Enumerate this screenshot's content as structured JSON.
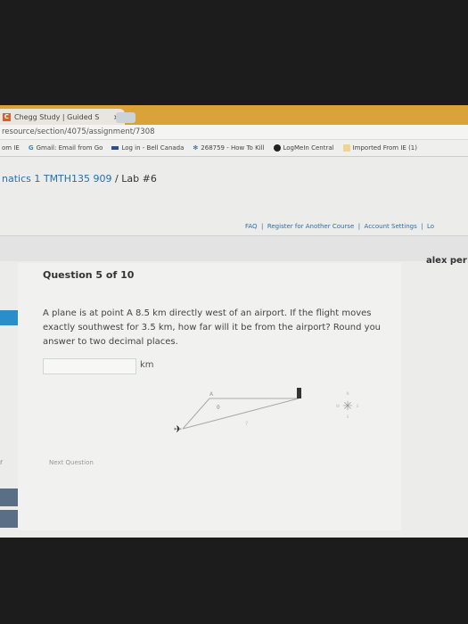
{
  "browser": {
    "tab_title": "Chegg Study | Guided S",
    "tab_close": "×",
    "favicon": "C",
    "address": "resource/section/4075/assignment/7308",
    "bookmarks": [
      {
        "label": "om IE",
        "icon": ""
      },
      {
        "label": "Gmail: Email from Go",
        "icon": "google-icon"
      },
      {
        "label": "Log in - Bell Canada",
        "icon": "bell-icon"
      },
      {
        "label": "268759 - How To Kill",
        "icon": "pinwheel-icon"
      },
      {
        "label": "LogMeIn Central",
        "icon": "logmein-icon"
      },
      {
        "label": "Imported From IE (1)",
        "icon": "folder-icon"
      }
    ]
  },
  "breadcrumb": {
    "course": "natics 1 TMTH135 909",
    "separator": " / ",
    "current": "Lab #6"
  },
  "top_links": [
    "FAQ",
    "Register for Another Course",
    "Account Settings",
    "Lo"
  ],
  "user_name": "alex per",
  "question": {
    "title": "Question 5 of 10",
    "text": "A plane is at point A 8.5 km directly west of an airport. If the flight moves exactly southwest for 3.5 km, how far will it be from the airport? Round you answer to two decimal places.",
    "answer_value": "",
    "unit": "km",
    "figure": {
      "point_label": "A",
      "angle_label": "θ",
      "unknown_label": "?",
      "compass": [
        "N",
        "E",
        "S",
        "W"
      ]
    }
  },
  "next_button": "Next Question",
  "side_fragment": "r"
}
